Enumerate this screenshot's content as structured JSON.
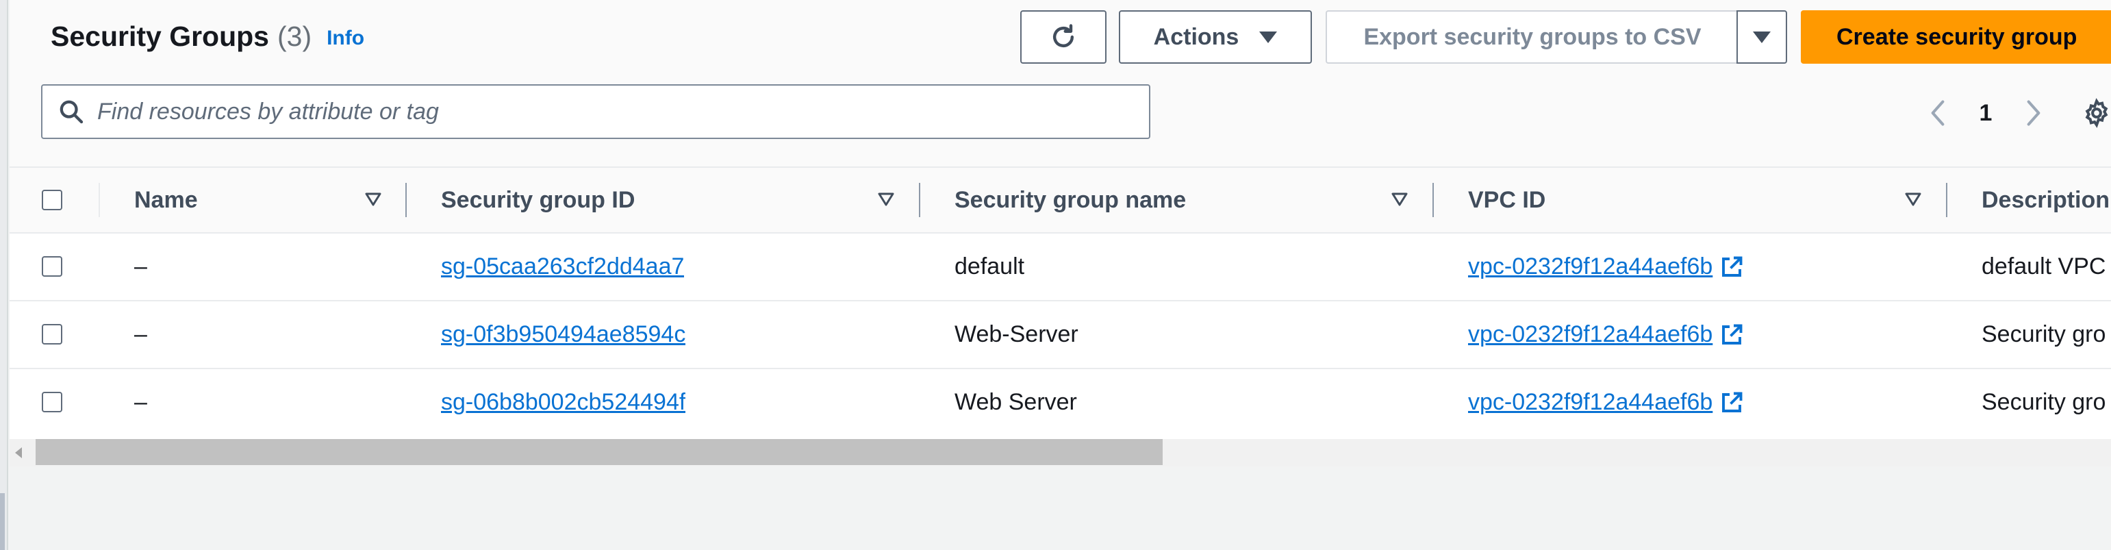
{
  "header": {
    "title": "Security Groups",
    "count": "(3)",
    "info_label": "Info"
  },
  "toolbar": {
    "refresh_icon": "refresh-icon",
    "actions_label": "Actions",
    "export_label": "Export security groups to CSV",
    "create_label": "Create security group"
  },
  "search": {
    "placeholder": "Find resources by attribute or tag",
    "value": ""
  },
  "pagination": {
    "current_page": "1"
  },
  "table": {
    "columns": [
      "Name",
      "Security group ID",
      "Security group name",
      "VPC ID",
      "Description"
    ],
    "rows": [
      {
        "name": "–",
        "group_id": "sg-05caa263cf2dd4aa7",
        "group_name": "default",
        "vpc_id": "vpc-0232f9f12a44aef6b",
        "description": "default VPC"
      },
      {
        "name": "–",
        "group_id": "sg-0f3b950494ae8594c",
        "group_name": "Web-Server",
        "vpc_id": "vpc-0232f9f12a44aef6b",
        "description": "Security gro"
      },
      {
        "name": "–",
        "group_id": "sg-06b8b002cb524494f",
        "group_name": "Web Server",
        "vpc_id": "vpc-0232f9f12a44aef6b",
        "description": "Security gro"
      }
    ]
  },
  "colors": {
    "primary_button": "#ff9900",
    "link": "#0972d3",
    "text": "#16191f",
    "muted": "#687078"
  },
  "icons": {
    "refresh": "refresh-icon",
    "dropdown": "caret-down-icon",
    "search": "search-icon",
    "prev": "chevron-left-icon",
    "next": "chevron-right-icon",
    "settings": "gear-icon",
    "sort": "sort-caret-icon",
    "external_link": "external-link-icon"
  }
}
